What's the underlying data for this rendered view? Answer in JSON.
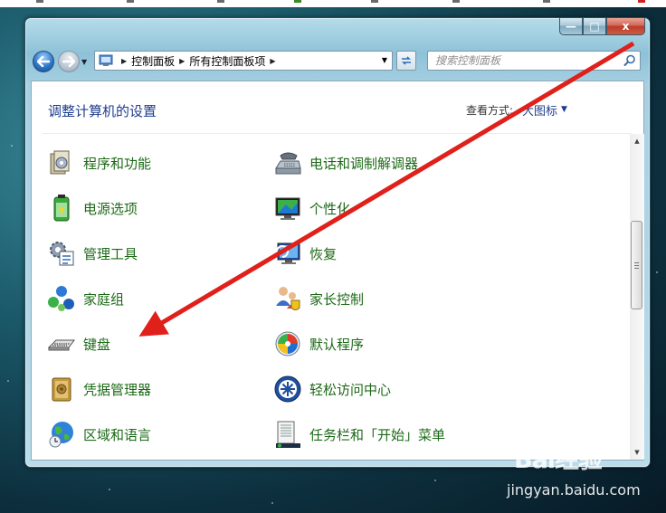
{
  "window": {
    "caption_min": "—",
    "caption_max": "□",
    "caption_close": "x"
  },
  "breadcrumb": {
    "items": [
      "控制面板",
      "所有控制面板项"
    ]
  },
  "search": {
    "placeholder": "搜索控制面板"
  },
  "header": {
    "title": "调整计算机的设置",
    "view_label": "查看方式:",
    "view_value": "大图标"
  },
  "items_left": [
    {
      "label": "程序和功能",
      "icon": "programs-features-icon"
    },
    {
      "label": "电源选项",
      "icon": "power-options-icon"
    },
    {
      "label": "管理工具",
      "icon": "admin-tools-icon"
    },
    {
      "label": "家庭组",
      "icon": "homegroup-icon"
    },
    {
      "label": "键盘",
      "icon": "keyboard-icon"
    },
    {
      "label": "凭据管理器",
      "icon": "credential-manager-icon"
    },
    {
      "label": "区域和语言",
      "icon": "region-language-icon"
    }
  ],
  "items_right": [
    {
      "label": "电话和调制解调器",
      "icon": "phone-modem-icon"
    },
    {
      "label": "个性化",
      "icon": "personalization-icon"
    },
    {
      "label": "恢复",
      "icon": "recovery-icon"
    },
    {
      "label": "家长控制",
      "icon": "parental-controls-icon"
    },
    {
      "label": "默认程序",
      "icon": "default-programs-icon"
    },
    {
      "label": "轻松访问中心",
      "icon": "ease-of-access-icon"
    },
    {
      "label": "任务栏和「开始」菜单",
      "icon": "taskbar-start-menu-icon"
    }
  ],
  "annotation": {
    "color": "#e0201b"
  },
  "watermark": {
    "logo": "Bai经验",
    "url": "jingyan.baidu.com"
  },
  "colors": {
    "link_green": "#1d6a17",
    "title_blue": "#1e3c8c"
  }
}
